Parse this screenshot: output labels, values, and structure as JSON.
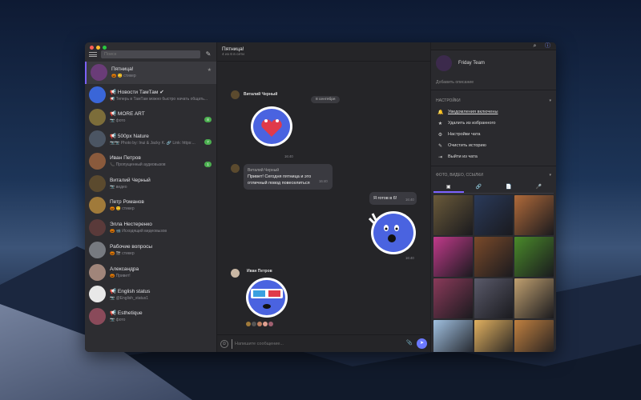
{
  "sidebar": {
    "search_placeholder": "Поиск",
    "chats": [
      {
        "name": "Пятница!",
        "preview": "🎃 😊 стикер",
        "color": "#6a3c78",
        "pinned": true,
        "active": true
      },
      {
        "name": "📢 Новости ТамТам ✔",
        "preview": "📢 Теперь в ТамТам можно быстро начать общать...",
        "color": "#3a66d8"
      },
      {
        "name": "📢 MORE ART",
        "preview": "📷 фото",
        "color": "#7c6d3a",
        "badge": "8"
      },
      {
        "name": "📢 500px Nature",
        "preview": "📷📷 Photo by: Inui & Jacky K. 🔗 Link: https:...",
        "color": "#4b5563",
        "badge": "7"
      },
      {
        "name": "Иван Петров",
        "preview": "📞 Пропущенный аудиовызов",
        "color": "#8a5a3c",
        "badge": "1"
      },
      {
        "name": "Виталий Черный",
        "preview": "📷 видео",
        "color": "#5b4a2e"
      },
      {
        "name": "Петр Романов",
        "preview": "🎃 😊 стикер",
        "color": "#a07a3a"
      },
      {
        "name": "Элла Нестеренко",
        "preview": "🎃 📹 Исходящий видеовызов",
        "color": "#5a3a3a"
      },
      {
        "name": "Рабочие вопросы",
        "preview": "🎃 🎬 стикер",
        "color": "#777a80"
      },
      {
        "name": "Александра",
        "preview": "🎃 Привет!",
        "color": "#a0857a"
      },
      {
        "name": "📢 English status",
        "preview": "📷 @English_status1",
        "color": "#e8e8e8"
      },
      {
        "name": "📢 Esthetique",
        "preview": "📷 фото",
        "color": "#8a4a5a"
      }
    ]
  },
  "chat": {
    "title": "Пятница!",
    "subtitle": "4 из 6 в сети",
    "date_label": "8 сентября",
    "messages": {
      "author1": "Виталий Черный",
      "time1": "16:40",
      "author2": "Виталий Черный",
      "text2_line1": "Привет! Сегодня пятница и это",
      "text2_line2": "отличный повод повеселиться",
      "time2": "16:40",
      "text3": "Я готов в 6!",
      "time3": "16:40",
      "time4": "16:40",
      "author5": "Иван Петров"
    },
    "input_placeholder": "Напишите сообщение..."
  },
  "panel": {
    "profile_name": "Friday Team",
    "add_description": "Добавить описание",
    "settings_header": "Настройки",
    "settings": [
      {
        "label": "Уведомления включены",
        "icon": "bell-icon",
        "glyph": "🔔"
      },
      {
        "label": "Удалить из избранного",
        "icon": "star-icon",
        "glyph": "★"
      },
      {
        "label": "Настройки чата",
        "icon": "gear-icon",
        "glyph": "⚙"
      },
      {
        "label": "Очистить историю",
        "icon": "brush-icon",
        "glyph": "✎"
      },
      {
        "label": "Выйти из чата",
        "icon": "exit-icon",
        "glyph": "⇥"
      }
    ],
    "media_header": "Фото, видео, ссылки",
    "media_tabs": [
      "▣",
      "🔗",
      "📄",
      "🎤"
    ],
    "photos": [
      "#6a5a3a",
      "#2a3a5a",
      "#b06a3a",
      "#c03a8a",
      "#7a4a2a",
      "#4a8a2a",
      "#8a3a5a",
      "#5a5a6a",
      "#c0a070",
      "#a0c0e0",
      "#e0b060",
      "#c08040"
    ]
  },
  "colors": {
    "accent": "#7b61ff",
    "send": "#6b79ff",
    "badge": "#4caf50"
  }
}
